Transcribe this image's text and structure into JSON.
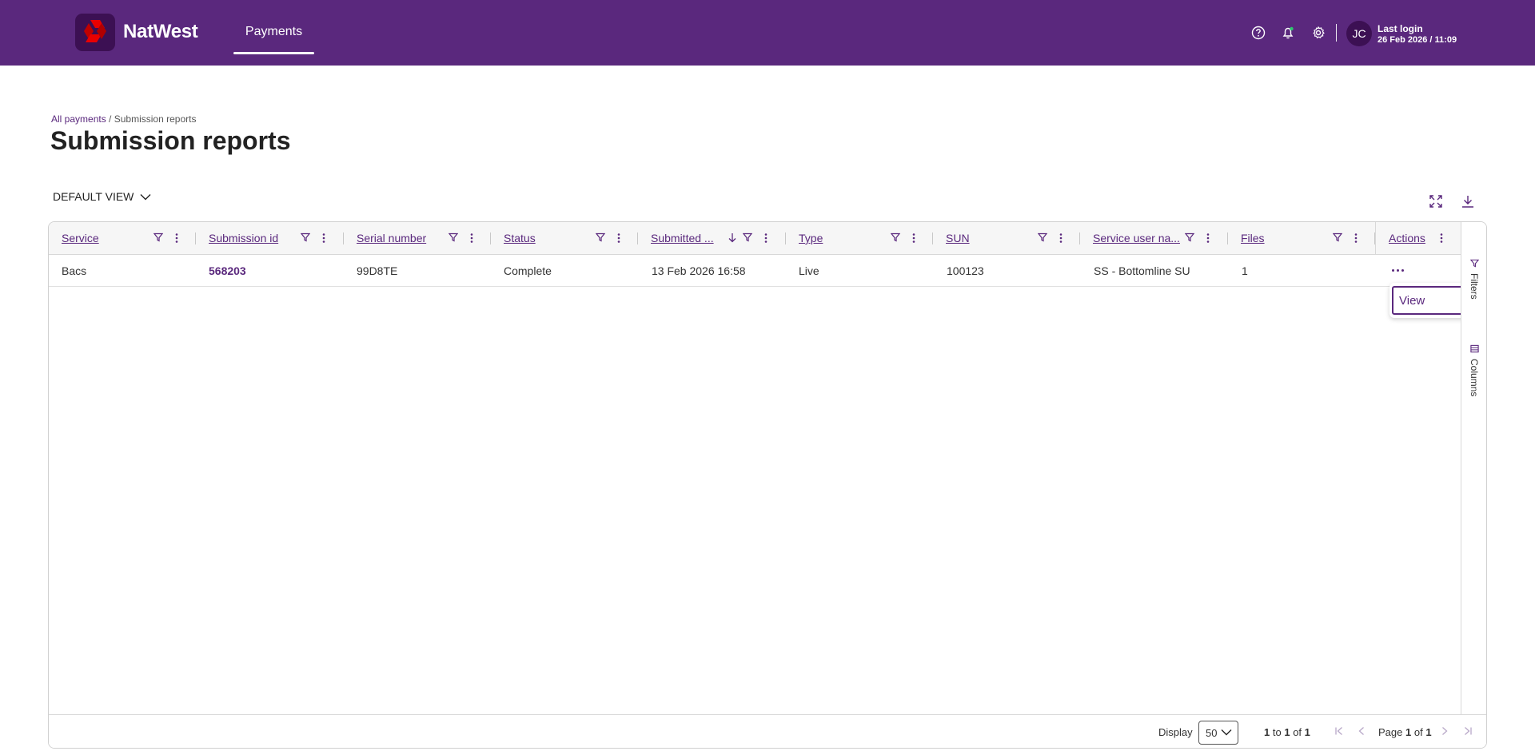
{
  "app": {
    "brand": "NatWest",
    "nav_tab": "Payments",
    "user_initials": "JC",
    "last_login_label": "Last login",
    "last_login_value": "26 Feb 2026 / 11:09"
  },
  "page": {
    "breadcrumb_link": "All payments",
    "breadcrumb_sep": "/",
    "breadcrumb_current": "Submission reports",
    "title": "Submission reports",
    "view_label": "DEFAULT VIEW"
  },
  "grid": {
    "columns": [
      {
        "label": "Service"
      },
      {
        "label": "Submission id"
      },
      {
        "label": "Serial number"
      },
      {
        "label": "Status"
      },
      {
        "label": "Submitted ..."
      },
      {
        "label": "Type"
      },
      {
        "label": "SUN"
      },
      {
        "label": "Service user na..."
      },
      {
        "label": "Files"
      },
      {
        "label": "Actions"
      }
    ],
    "rows": [
      {
        "service": "Bacs",
        "submission_id": "568203",
        "serial_number": "99D8TE",
        "status": "Complete",
        "submitted": "13 Feb 2026 16:58",
        "type": "Live",
        "sun": "100123",
        "service_user_name": "SS - Bottomline SU",
        "files": "1"
      }
    ],
    "row_menu": {
      "view": "View"
    },
    "side_panel": {
      "filters": "Filters",
      "columns": "Columns"
    }
  },
  "footer": {
    "display_label": "Display",
    "page_size": "50",
    "range_from": "1",
    "range_to_word": "to",
    "range_to": "1",
    "range_of_word": "of",
    "range_total": "1",
    "page_word": "Page",
    "page_current": "1",
    "page_of_word": "of",
    "page_total": "1"
  },
  "colors": {
    "brand_purple": "#5a287d",
    "brand_dark": "#3c1053",
    "logo_red": "#e90000"
  },
  "icons": [
    "help-icon",
    "bell-icon",
    "gear-icon",
    "chevron-down-icon",
    "expand-icon",
    "download-icon",
    "filter-icon",
    "kebab-icon",
    "sort-desc-icon",
    "columns-icon",
    "first-page-icon",
    "prev-page-icon",
    "next-page-icon",
    "last-page-icon"
  ]
}
